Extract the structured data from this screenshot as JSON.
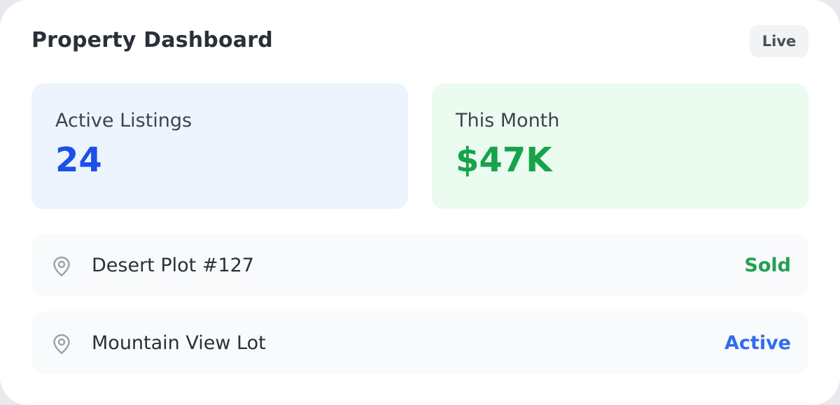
{
  "header": {
    "title": "Property Dashboard",
    "badge": "Live"
  },
  "stats": [
    {
      "label": "Active Listings",
      "value": "24",
      "accent": "#1e4fe8"
    },
    {
      "label": "This Month",
      "value": "$47K",
      "accent": "#16a34a"
    }
  ],
  "listings": [
    {
      "icon": "map-pin-icon",
      "name": "Desert Plot #127",
      "status": "Sold",
      "status_color": "#22a052"
    },
    {
      "icon": "map-pin-icon",
      "name": "Mountain View Lot",
      "status": "Active",
      "status_color": "#2f6cf0"
    }
  ]
}
